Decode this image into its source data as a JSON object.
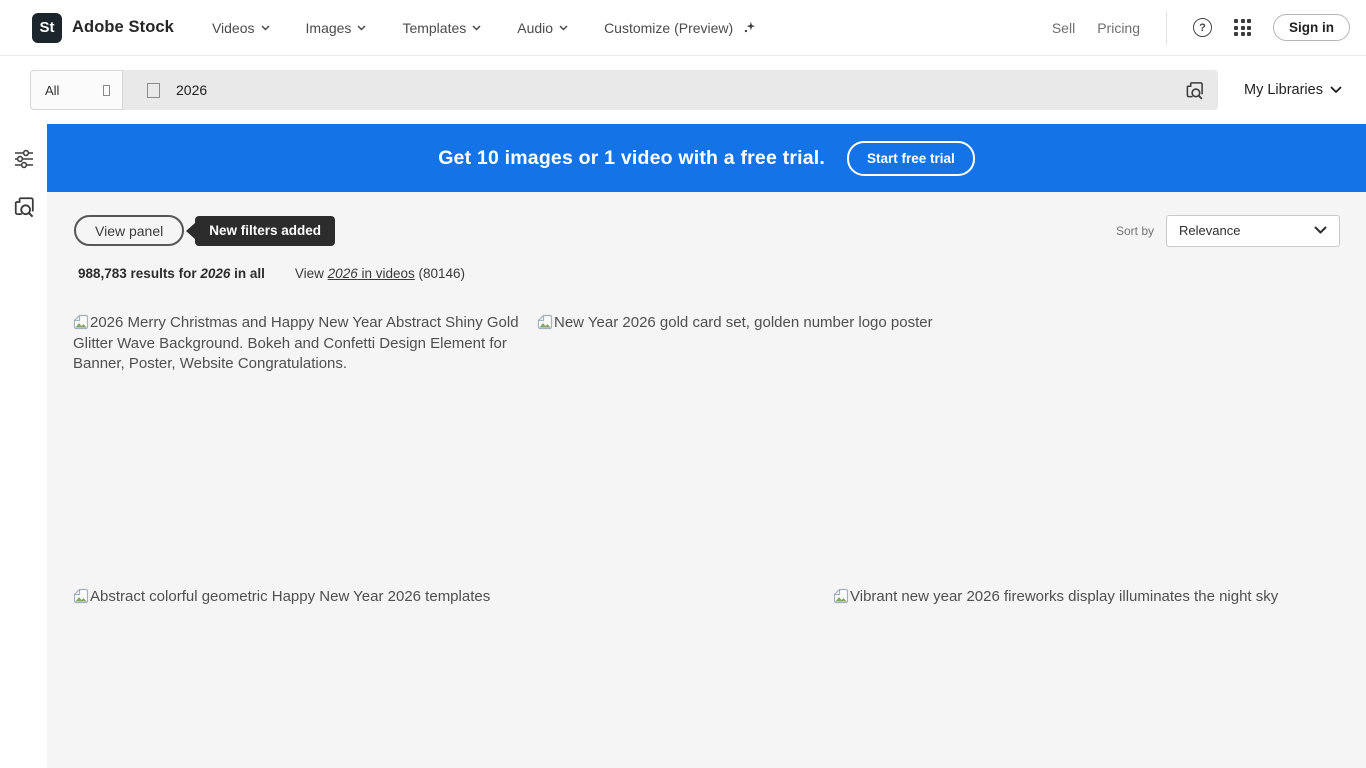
{
  "header": {
    "logo_square": "St",
    "brand": "Adobe Stock",
    "nav": [
      {
        "label": "Videos"
      },
      {
        "label": "Images"
      },
      {
        "label": "Templates"
      },
      {
        "label": "Audio"
      }
    ],
    "customize_label": "Customize (Preview)",
    "sell": "Sell",
    "pricing": "Pricing",
    "sign_in": "Sign in"
  },
  "search": {
    "scope_value": "All",
    "query": "2026",
    "my_libraries_label": "My Libraries"
  },
  "banner": {
    "text": "Get 10 images or 1 video with a free trial.",
    "cta": "Start free trial",
    "bg_color": "#1473e6"
  },
  "toolbar": {
    "view_panel_label": "View panel",
    "tooltip_text": "New filters added",
    "sort_by_label": "Sort by",
    "sort_value": "Relevance"
  },
  "results": {
    "count_prefix": "988,783 results for ",
    "count_term": "2026",
    "count_suffix": " in all",
    "view_prefix": "View ",
    "link_term": "2026",
    "link_rest": " in videos",
    "link_count": " (80146)"
  },
  "items": [
    "2026 Merry Christmas and Happy New Year Abstract Shiny Gold Glitter Wave Background. Bokeh and Confetti Design Element for Banner, Poster, Website Congratulations.",
    "New Year 2026 gold card set, golden number logo poster",
    "Abstract colorful geometric Happy New Year 2026 templates",
    "Vibrant new year 2026 fireworks display illuminates the night sky"
  ],
  "colors": {
    "banner_blue": "#1473e6",
    "page_bg": "#f5f5f5",
    "tooltip_bg": "#2c2c2c"
  }
}
